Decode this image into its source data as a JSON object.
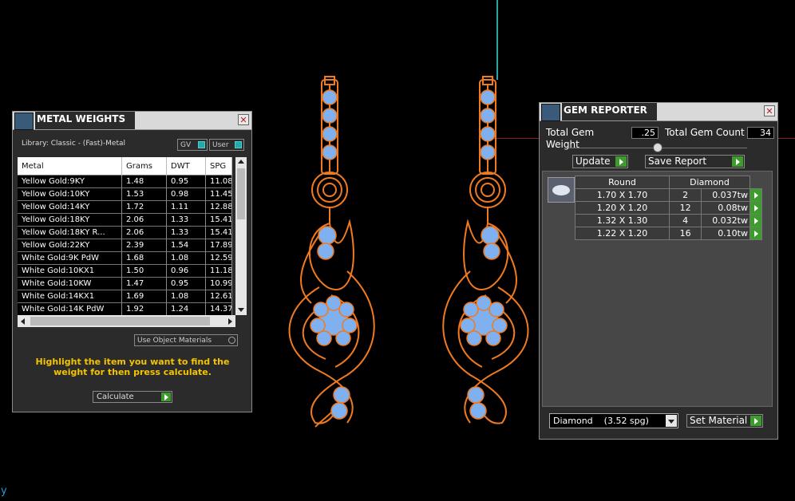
{
  "metal_weights": {
    "title": "METAL WEIGHTS",
    "library": "Library: Classic - (Fast)-Metal",
    "toggle_gv": "GV",
    "toggle_user": "User",
    "columns": [
      "Metal",
      "Grams",
      "DWT",
      "SPG"
    ],
    "rows": [
      [
        "Yellow Gold:9KY",
        "1.48",
        "0.95",
        "11.08"
      ],
      [
        "Yellow Gold:10KY",
        "1.53",
        "0.98",
        "11.45"
      ],
      [
        "Yellow Gold:14KY",
        "1.72",
        "1.11",
        "12.88"
      ],
      [
        "Yellow Gold:18KY",
        "2.06",
        "1.33",
        "15.41"
      ],
      [
        "Yellow Gold:18KY R...",
        "2.06",
        "1.33",
        "15.41"
      ],
      [
        "Yellow Gold:22KY",
        "2.39",
        "1.54",
        "17.89"
      ],
      [
        "White Gold:9K PdW",
        "1.68",
        "1.08",
        "12.59"
      ],
      [
        "White Gold:10KX1",
        "1.50",
        "0.96",
        "11.18"
      ],
      [
        "White Gold:10KW",
        "1.47",
        "0.95",
        "10.99"
      ],
      [
        "White Gold:14KX1",
        "1.69",
        "1.08",
        "12.61"
      ],
      [
        "White Gold:14K PdW",
        "1.92",
        "1.24",
        "14.37"
      ]
    ],
    "use_object_materials": "Use Object Materials",
    "hint": "Highlight the item you want to find the weight for then press calculate.",
    "calculate": "Calculate"
  },
  "gem_reporter": {
    "title": "GEM REPORTER",
    "total_weight_label": "Total Gem Weight",
    "total_weight_value": ".25",
    "total_count_label": "Total Gem Count",
    "total_count_value": "34",
    "update": "Update",
    "save_report": "Save Report",
    "shape_header": "Round",
    "material_header": "Diamond",
    "rows": [
      [
        "1.70 X 1.70",
        "2",
        "0.037tw"
      ],
      [
        "1.20 X 1.20",
        "12",
        "0.08tw"
      ],
      [
        "1.32 X 1.30",
        "4",
        "0.032tw"
      ],
      [
        "1.22 X 1.20",
        "16",
        "0.10tw"
      ]
    ],
    "material_select": "Diamond    (3.52 spg)",
    "set_material": "Set Material"
  },
  "colors": {
    "wire": "#f07a20",
    "gem": "#7fb0f0",
    "accent": "#f5c400",
    "play": "#3c9c2c"
  },
  "corner_text": "y"
}
